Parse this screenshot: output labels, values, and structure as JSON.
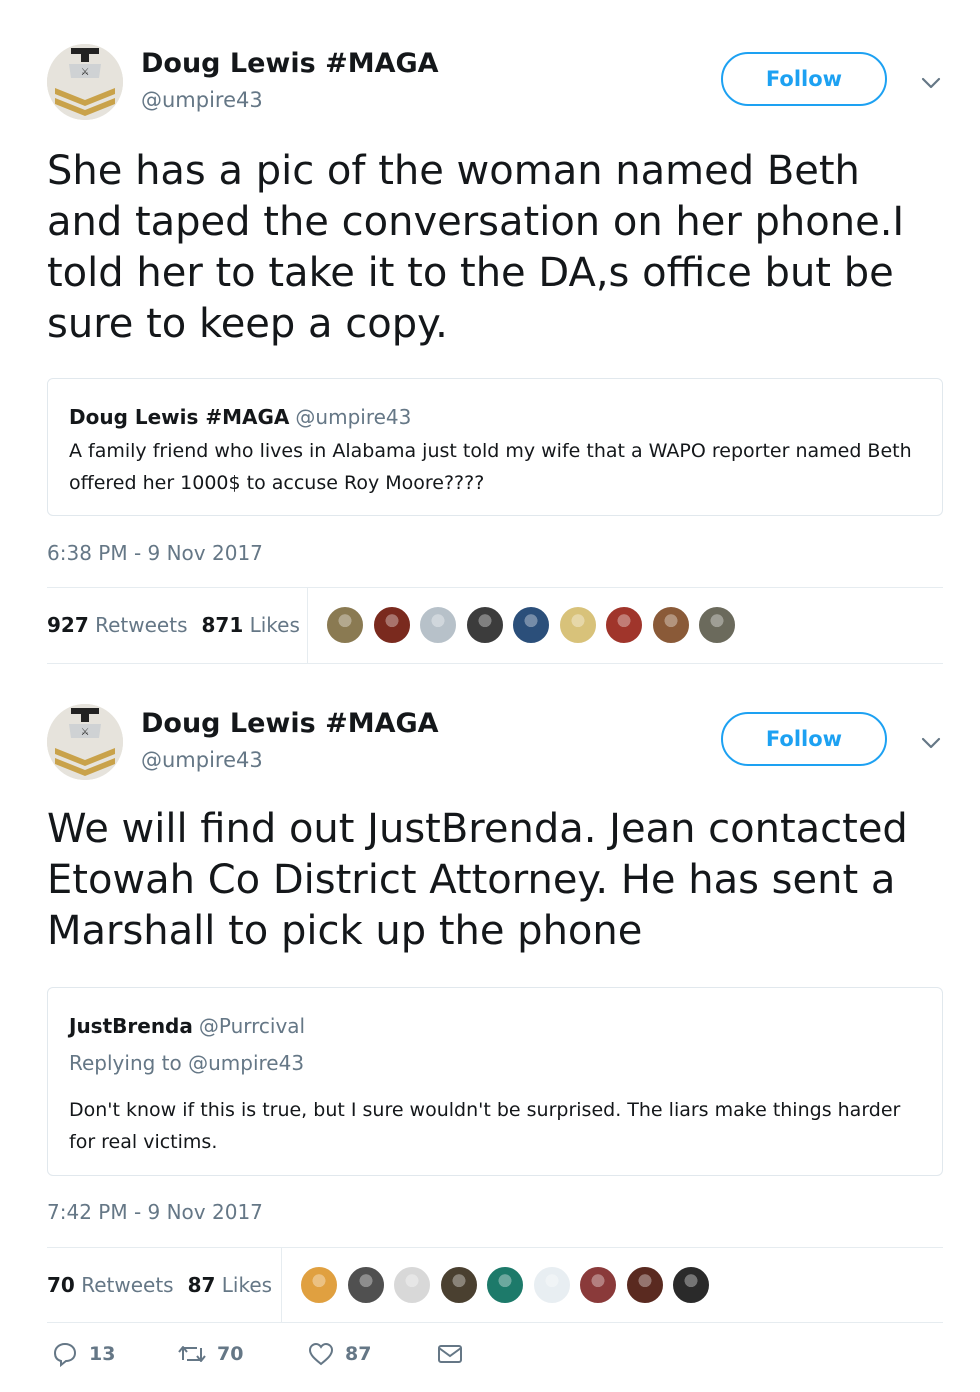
{
  "tweets": [
    {
      "author": {
        "name": "Doug Lewis #MAGA",
        "handle": "@umpire43"
      },
      "follow_label": "Follow",
      "text": "She has a pic of the woman named Beth and taped the conversation on her phone.I told her to take it to the DA,s office but be sure to keep a copy.",
      "quote": {
        "name": "Doug Lewis #MAGA",
        "handle": "@umpire43",
        "replying_to": "",
        "text": "A family friend who lives in Alabama  just told my wife that a WAPO reporter named Beth offered her 1000$ to accuse Roy Moore????"
      },
      "timestamp": "6:38 PM - 9 Nov 2017",
      "stats": {
        "retweets_count": "927",
        "retweets_label": "Retweets",
        "likes_count": "871",
        "likes_label": "Likes"
      },
      "liker_avatars": [
        "#8a7a52",
        "#7a2a1e",
        "#b7c1c9",
        "#3c3c3c",
        "#2b4f7a",
        "#d8c27a",
        "#a0352b",
        "#8a5a38",
        "#6b6a5c"
      ]
    },
    {
      "author": {
        "name": "Doug Lewis #MAGA",
        "handle": "@umpire43"
      },
      "follow_label": "Follow",
      "text": "We will find out JustBrenda. Jean contacted Etowah Co District Attorney. He has sent a Marshall to pick up the phone",
      "quote": {
        "name": "JustBrenda",
        "handle": "@Purrcival",
        "replying_to": "Replying to @umpire43",
        "text": "Don't know if this is true, but I sure wouldn't be surprised. The liars make things harder for real victims."
      },
      "timestamp": "7:42 PM - 9 Nov 2017",
      "stats": {
        "retweets_count": "70",
        "retweets_label": "Retweets",
        "likes_count": "87",
        "likes_label": "Likes"
      },
      "liker_avatars": [
        "#e0a040",
        "#505050",
        "#d8d8d8",
        "#4a4030",
        "#1d7a6a",
        "#e8eef2",
        "#8a3a3a",
        "#5a2a20",
        "#2a2a2a"
      ]
    }
  ],
  "actions": {
    "reply_count": "13",
    "retweet_count": "70",
    "like_count": "87",
    "icons": [
      "reply-icon",
      "retweet-icon",
      "like-icon",
      "message-icon"
    ]
  },
  "colors": {
    "accent": "#1da1f2",
    "muted": "#657786",
    "border": "#e1e8ed"
  }
}
